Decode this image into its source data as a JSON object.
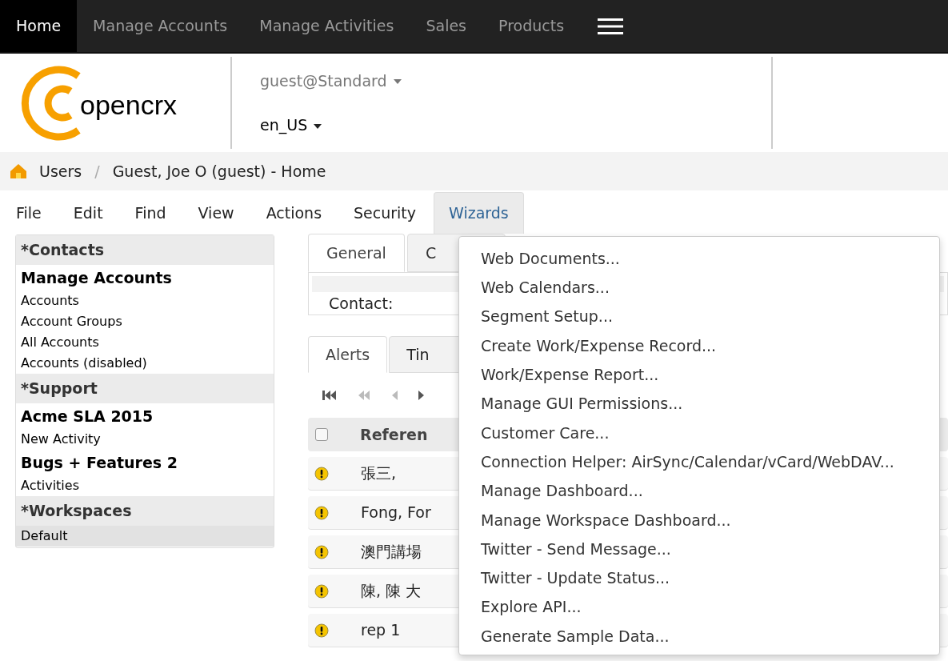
{
  "top_nav": [
    {
      "label": "Home",
      "selected": true
    },
    {
      "label": "Manage Accounts",
      "selected": false
    },
    {
      "label": "Manage Activities",
      "selected": false
    },
    {
      "label": "Sales",
      "selected": false
    },
    {
      "label": "Products",
      "selected": false
    }
  ],
  "logo": {
    "text": "opencrx"
  },
  "header": {
    "user": "guest@Standard",
    "locale": "en_US"
  },
  "breadcrumb": {
    "items": [
      "Users",
      "Guest, Joe O (guest) - Home"
    ],
    "separator": "/"
  },
  "menu_bar": [
    {
      "label": "File",
      "selected": false
    },
    {
      "label": "Edit",
      "selected": false
    },
    {
      "label": "Find",
      "selected": false
    },
    {
      "label": "View",
      "selected": false
    },
    {
      "label": "Actions",
      "selected": false
    },
    {
      "label": "Security",
      "selected": false
    },
    {
      "label": "Wizards",
      "selected": true
    }
  ],
  "sidebar": [
    {
      "kind": "section",
      "label": "*Contacts"
    },
    {
      "kind": "group",
      "label": "Manage Accounts",
      "selected": false
    },
    {
      "kind": "item",
      "label": "Accounts",
      "selected": false
    },
    {
      "kind": "item",
      "label": "Account Groups",
      "selected": false
    },
    {
      "kind": "item",
      "label": "All Accounts",
      "selected": false
    },
    {
      "kind": "item",
      "label": "Accounts (disabled)",
      "selected": false
    },
    {
      "kind": "section",
      "label": "*Support"
    },
    {
      "kind": "group",
      "label": "Acme SLA 2015",
      "selected": false
    },
    {
      "kind": "item",
      "label": "New Activity",
      "selected": false
    },
    {
      "kind": "group",
      "label": "Bugs + Features 2",
      "selected": false
    },
    {
      "kind": "item",
      "label": "Activities",
      "selected": false
    },
    {
      "kind": "section",
      "label": "*Workspaces"
    },
    {
      "kind": "item",
      "label": "Default",
      "selected": true
    }
  ],
  "main_tabs": [
    {
      "label": "General",
      "selected": true
    },
    {
      "label": "C",
      "selected": false
    }
  ],
  "contact_label": "Contact:",
  "grid_tabs": [
    {
      "label": "Alerts",
      "selected": true
    },
    {
      "label": "Tin",
      "selected": false
    }
  ],
  "table": {
    "select_all_checked": false,
    "columns": [
      "Referen"
    ],
    "rows": [
      [
        "張三,"
      ],
      [
        "Fong, For"
      ],
      [
        "澳門講場"
      ],
      [
        "陳, 陳 大"
      ],
      [
        "rep 1"
      ]
    ]
  },
  "wizards_menu": [
    "Web Documents...",
    "Web Calendars...",
    "Segment Setup...",
    "Create Work/Expense Record...",
    "Work/Expense Report...",
    "Manage GUI Permissions...",
    "Customer Care...",
    "Connection Helper: AirSync/Calendar/vCard/WebDAV...",
    "Manage Dashboard...",
    "Manage Workspace Dashboard...",
    "Twitter - Send Message...",
    "Twitter - Update Status...",
    "Explore API...",
    "Generate Sample Data..."
  ]
}
